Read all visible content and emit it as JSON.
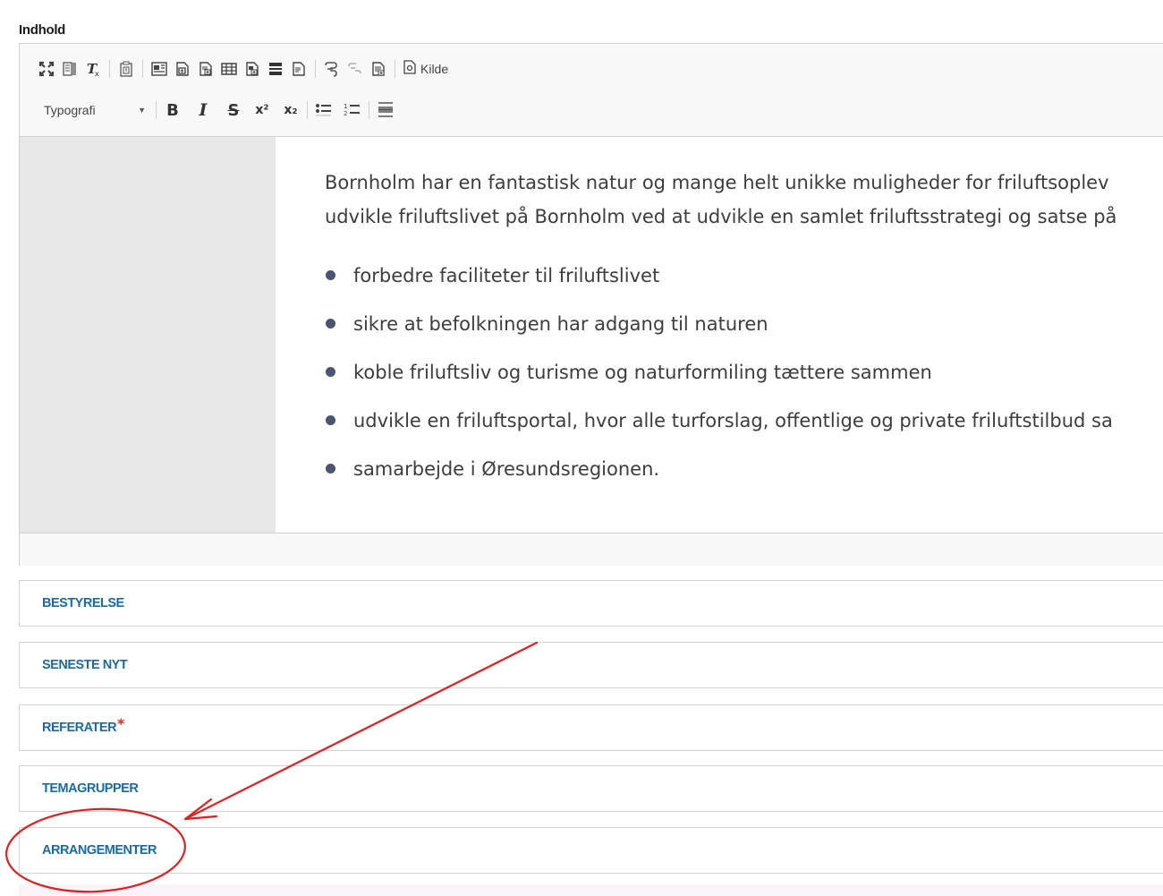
{
  "field": {
    "label": "Indhold"
  },
  "toolbar": {
    "source_label": "Kilde",
    "format_label": "Typografi",
    "row1_icons": [
      "maximize-icon",
      "show-blocks-icon",
      "remove-format-icon",
      "paste-from-word-icon",
      "template-icon",
      "insert-block-icon",
      "insert-block-icon",
      "table-icon",
      "insert-block-icon",
      "horizontal-rule-block-icon",
      "insert-block-icon",
      "link-icon",
      "unlink-icon",
      "embed-icon",
      "source-icon"
    ],
    "row2_icons": [
      "bold-icon",
      "italic-icon",
      "strikethrough-icon",
      "superscript-icon",
      "subscript-icon",
      "bulleted-list-icon",
      "numbered-list-icon",
      "horizontal-line-icon"
    ],
    "bold_glyph": "B",
    "italic_glyph": "I",
    "strike_glyph": "S",
    "sup_glyph": "x²",
    "sub_glyph": "x₂"
  },
  "content": {
    "paragraph_lines": [
      "Bornholm har en fantastisk natur og mange helt unikke muligheder for friluftsoplev",
      "udvikle friluftslivet på Bornholm ved at udvikle en samlet friluftsstrategi og satse på"
    ],
    "bullets": [
      "forbedre faciliteter til friluftslivet",
      "sikre at befolkningen har adgang til naturen",
      "koble friluftsliv og turisme og naturformiling tættere sammen",
      "udvikle en friluftsportal, hvor alle turforslag, offentlige og private friluftstilbud sa",
      "samarbejde i Øresundsregionen."
    ]
  },
  "sections": [
    {
      "label": "BESTYRELSE",
      "required": false
    },
    {
      "label": "SENESTE NYT",
      "required": false
    },
    {
      "label": "REFERATER",
      "required": true,
      "required_mark": "*"
    },
    {
      "label": "TEMAGRUPPER",
      "required": false
    },
    {
      "label": "ARRANGEMENTER",
      "required": false,
      "highlighted": true
    }
  ],
  "colors": {
    "section_label": "#1a6aa6",
    "required": "#e0291f",
    "annotation": "#e02020",
    "bullet": "#4a5573"
  }
}
